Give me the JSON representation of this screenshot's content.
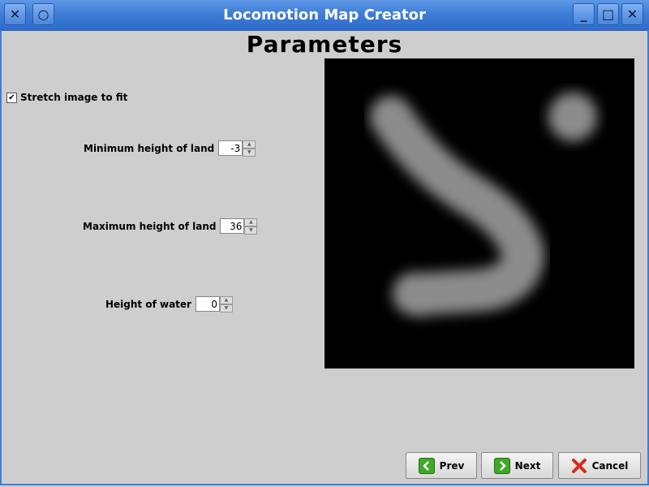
{
  "window": {
    "title": "Locomotion Map Creator",
    "close_glyph": "✕",
    "menu_glyph": "○",
    "minimize_glyph": "_",
    "maximize_glyph": "□",
    "close2_glyph": "✕"
  },
  "page": {
    "heading": "Parameters"
  },
  "options": {
    "stretch_label": "Stretch image to fit",
    "stretch_checked": true,
    "checkbox_glyph": "✔"
  },
  "fields": {
    "min_height": {
      "label": "Minimum height of land",
      "value": "-3"
    },
    "max_height": {
      "label": "Maximum height of land",
      "value": "36"
    },
    "water_height": {
      "label": "Height of water",
      "value": "0"
    },
    "spin_up": "▲",
    "spin_down": "▼"
  },
  "buttons": {
    "prev": "Prev",
    "next": "Next",
    "cancel": "Cancel"
  },
  "icons": {
    "prev": "arrow-left-icon",
    "next": "arrow-right-icon",
    "cancel": "red-x-icon"
  },
  "colors": {
    "titlebar": "#3f7dd6",
    "preview_bg": "#000000",
    "terrain": "#8c8c8c",
    "cancel_icon": "#d62b1f",
    "nav_icon": "#3fa72a"
  }
}
